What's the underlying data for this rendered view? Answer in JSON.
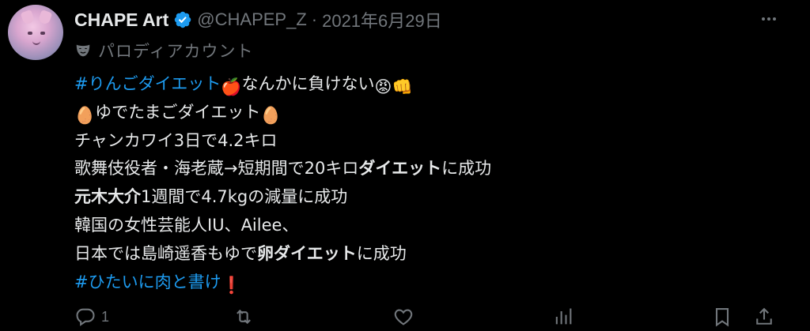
{
  "author": {
    "name": "CHAPE Art",
    "handle": "@CHAPEP_Z",
    "separator": "·",
    "date": "2021年6月29日",
    "label": "パロディアカウント"
  },
  "tweet": {
    "l1_hashtag": "#りんごダイエット",
    "l1_text": "なんかに負けない",
    "l2_text": "ゆでたまごダイエット",
    "l3_text": "チャンカワイ3日で4.2キロ",
    "l4_a": "歌舞伎役者・海老蔵→短期間で20キロ",
    "l4_b": "ダイエット",
    "l4_c": "に成功",
    "l5_a": "元木大介",
    "l5_b": "1週間で4.7kgの減量に成功",
    "l6_text": "韓国の女性芸能人IU、Ailee、",
    "l7_a": "日本では島崎遥香もゆで",
    "l7_b": "卵ダイエット",
    "l7_c": "に成功",
    "l8_hashtag": "#ひたいに肉と書け",
    "emoji_apple": "🍎",
    "emoji_angry": "😡",
    "emoji_fist": "👊",
    "emoji_egg": "🥚",
    "emoji_exclaim": "❗"
  },
  "actions": {
    "reply_count": "1"
  },
  "colors": {
    "background": "#000000",
    "text": "#e7e9ea",
    "muted": "#71767b",
    "link": "#1d9bf0",
    "verified": "#1d9bf0"
  },
  "icons": [
    "verified-icon",
    "more-icon",
    "parody-mask-icon",
    "reply-icon",
    "retweet-icon",
    "like-icon",
    "views-icon",
    "bookmark-icon",
    "share-icon"
  ]
}
